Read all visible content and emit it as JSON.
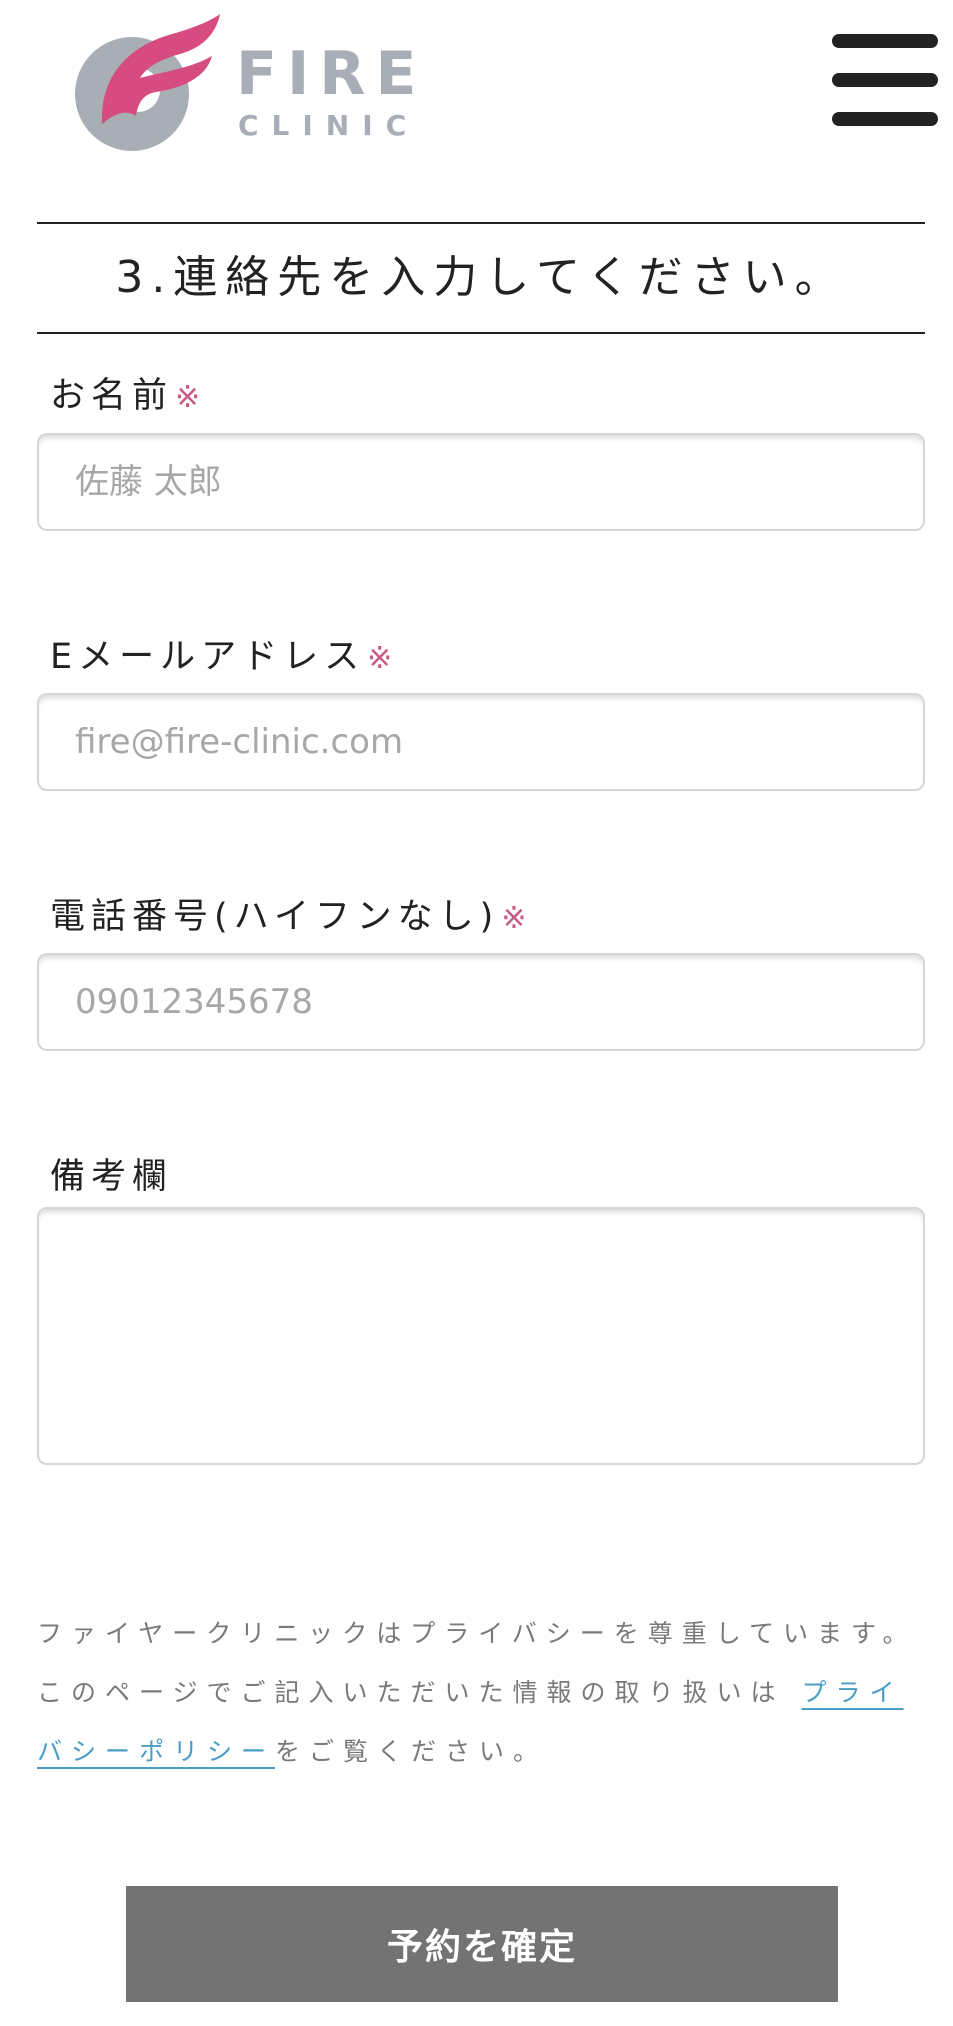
{
  "header": {
    "logo_word_main": "FIRE",
    "logo_word_sub": "CLINIC",
    "colors": {
      "logo_gray": "#a8adb6",
      "logo_pink": "#d64c80"
    },
    "menu_icon": "hamburger-menu-icon"
  },
  "form": {
    "section_title": "3.連絡先を入力してください。",
    "required_mark": "※",
    "name": {
      "label": "お名前",
      "placeholder": "佐藤 太郎"
    },
    "email": {
      "label": "Eメールアドレス",
      "placeholder": "fire@fire-clinic.com"
    },
    "phone": {
      "label": "電話番号(ハイフンなし)",
      "placeholder": "09012345678"
    },
    "notes": {
      "label": "備考欄",
      "placeholder": ""
    }
  },
  "privacy": {
    "line1": "ファイヤークリニックはプライバシーを尊重しています。",
    "line2_before": "このページでご記入いただいた情報の取り扱いは",
    "link_text": "プライバシーポリシー",
    "line2_after": "をご覧ください。"
  },
  "submit": {
    "label": "予約を確定"
  },
  "colors": {
    "required": "#c95a86",
    "link": "#4a9dc3",
    "button_bg": "#737373"
  }
}
